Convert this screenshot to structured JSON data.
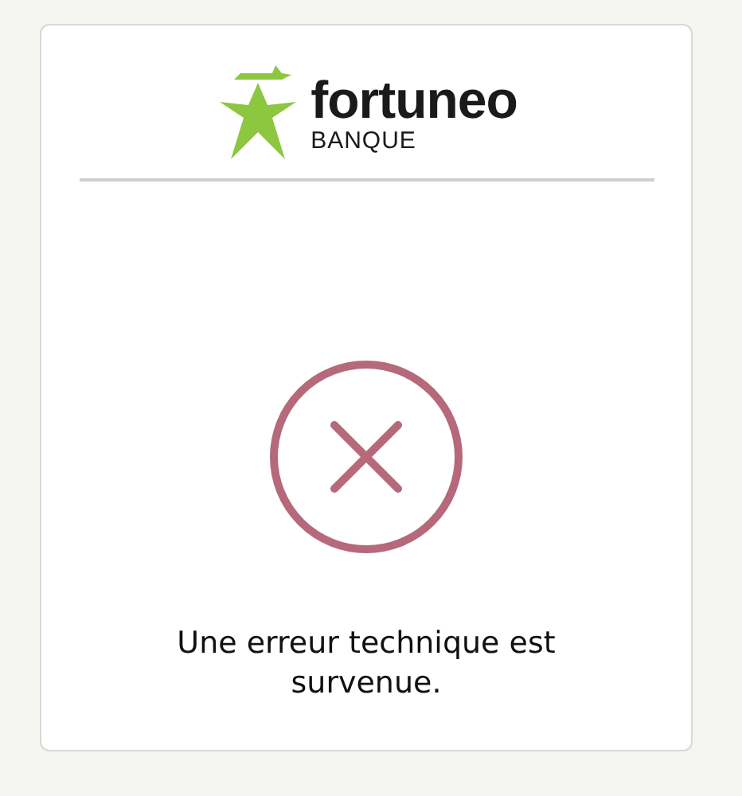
{
  "logo": {
    "name": "fortuneo",
    "tagline": "BANQUE"
  },
  "error": {
    "kind": "error",
    "message": "Une erreur technique est survenue."
  }
}
